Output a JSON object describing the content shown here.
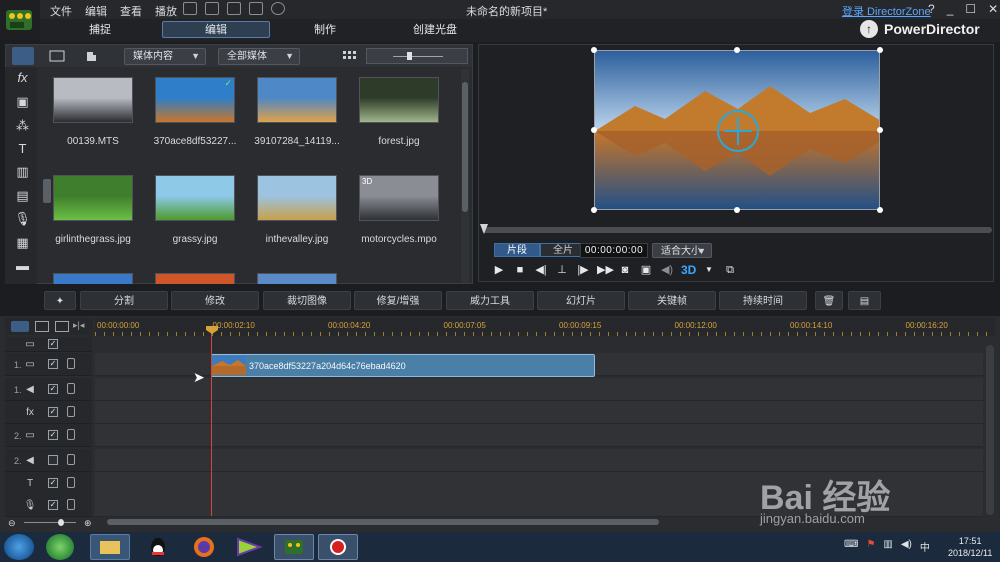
{
  "menubar": {
    "menus": [
      "文件",
      "编辑",
      "查看",
      "播放"
    ],
    "title": "未命名的新项目*",
    "login_link": "登录 DirectorZone",
    "window_controls": [
      "?",
      "_",
      "☐",
      "✕"
    ]
  },
  "modes": {
    "tabs": [
      "捕捉",
      "编辑",
      "制作",
      "创建光盘"
    ],
    "active": "编辑",
    "brand": "PowerDirector"
  },
  "library": {
    "dropdown_content": "媒体内容",
    "dropdown_filter": "全部媒体",
    "items": [
      {
        "name": "00139.MTS",
        "colors": [
          "#b8bcc2",
          "#2a2c30"
        ]
      },
      {
        "name": "370ace8df53227...",
        "colors": [
          "#2f7ec9",
          "#c7762a"
        ]
      },
      {
        "name": "39107284_14119...",
        "colors": [
          "#4e88c6",
          "#e0a04a"
        ]
      },
      {
        "name": "forest.jpg",
        "colors": [
          "#2e3b29",
          "#9fb58a"
        ]
      },
      {
        "name": "girlinthegrass.jpg",
        "colors": [
          "#3f7e2c",
          "#6cbf45"
        ]
      },
      {
        "name": "grassy.jpg",
        "colors": [
          "#8ec9e8",
          "#4c9a2e"
        ]
      },
      {
        "name": "inthevalley.jpg",
        "colors": [
          "#9cc3e0",
          "#c8a04c"
        ]
      },
      {
        "name": "motorcycles.mpo",
        "colors": [
          "#8a8e94",
          "#2e3136"
        ]
      }
    ],
    "badge_3d": "3D"
  },
  "preview": {
    "mode_clip": "片段",
    "mode_movie": "全片",
    "timecode": "00:00:00:00",
    "fit": "适合大小",
    "button_3d": "3D"
  },
  "functions": [
    "分割",
    "修改",
    "裁切图像",
    "修复/增强",
    "威力工具",
    "幻灯片",
    "关键帧",
    "持续时间"
  ],
  "timeline": {
    "ticks": [
      "00:00:00:00",
      "00:00:02:10",
      "00:00:04:20",
      "00:00:07:05",
      "00:00:09:15",
      "00:00:12:00",
      "00:00:14:10",
      "00:00:16:20"
    ],
    "clip_name": "370ace8df53227a204d64c76ebad4620",
    "tracks": [
      {
        "num": "",
        "icon": "▭",
        "checked": true
      },
      {
        "num": "1.",
        "icon": "▭",
        "checked": true
      },
      {
        "num": "1.",
        "icon": "◀",
        "checked": true
      },
      {
        "num": "",
        "icon": "fx",
        "checked": true
      },
      {
        "num": "2.",
        "icon": "▭",
        "checked": true
      },
      {
        "num": "2.",
        "icon": "◀",
        "checked": false
      },
      {
        "num": "",
        "icon": "T",
        "checked": true
      },
      {
        "num": "",
        "icon": "🎙",
        "checked": true
      }
    ]
  },
  "taskbar": {
    "time": "17:51",
    "date": "2018/12/11"
  },
  "watermark": {
    "text": "Bai 经验",
    "sub": "jingyan.baidu.com"
  }
}
